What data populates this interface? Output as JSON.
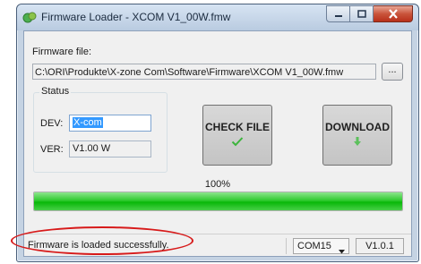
{
  "window": {
    "title": "Firmware Loader - XCOM V1_00W.fmw"
  },
  "firmware": {
    "label": "Firmware file:",
    "path": "C:\\ORI\\Produkte\\X-zone Com\\Software\\Firmware\\XCOM V1_00W.fmw",
    "browse_label": "..."
  },
  "status": {
    "legend": "Status",
    "dev_label": "DEV:",
    "dev_value": "X-com",
    "ver_label": "VER:",
    "ver_value": "V1.00 W"
  },
  "buttons": {
    "check_file": "CHECK FILE",
    "download": "DOWNLOAD"
  },
  "progress": {
    "percent_label": "100%",
    "value": 1.0
  },
  "statusbar": {
    "message": "Firmware is loaded successfully.",
    "com_port": "COM15",
    "app_version": "V1.0.1"
  },
  "colors": {
    "progress_green": "#09b809",
    "highlight_red": "#d71a1a",
    "selection_blue": "#3399ff"
  },
  "icons": [
    "app-icon",
    "minimize-icon",
    "maximize-icon",
    "close-icon",
    "checkmark-icon",
    "download-arrow-icon",
    "dropdown-arrow-icon"
  ]
}
